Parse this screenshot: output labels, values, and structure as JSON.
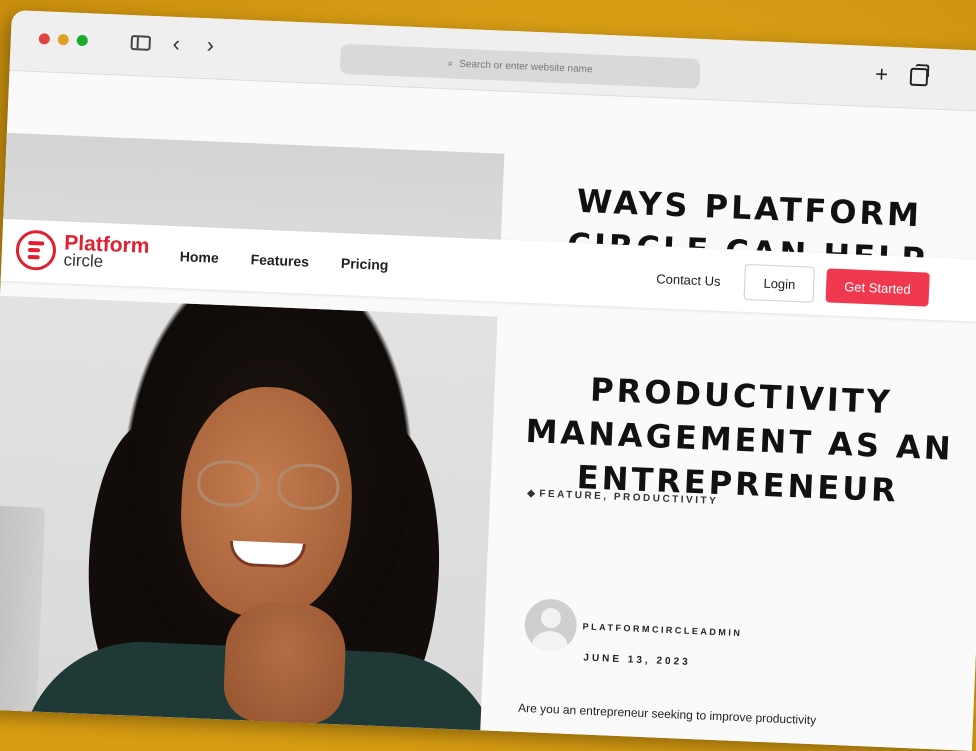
{
  "browser": {
    "address_placeholder": "Search or enter website name"
  },
  "logo": {
    "line1": "Platform",
    "line2": "circle"
  },
  "nav": {
    "links": [
      "Home",
      "Features",
      "Pricing"
    ],
    "contact": "Contact Us",
    "login": "Login",
    "cta": "Get Started"
  },
  "article": {
    "title_top": "WAYS PLATFORM CIRCLE CAN HELP",
    "title_bottom": "PRODUCTIVITY MANAGEMENT AS AN ENTREPRENEUR",
    "tags": "FEATURE, PRODUCTIVITY",
    "author": "PLATFORMCIRCLEADMIN",
    "date": "JUNE 13, 2023",
    "excerpt": "Are you an entrepreneur seeking to improve productivity"
  },
  "colors": {
    "background": "#d79c12",
    "brand_red": "#e21e2f",
    "cta_red": "#f0394f"
  },
  "icons": [
    "sidebar-icon",
    "back-icon",
    "forward-icon",
    "search-icon",
    "new-tab-icon",
    "tabs-icon",
    "tag-icon",
    "avatar-icon"
  ]
}
